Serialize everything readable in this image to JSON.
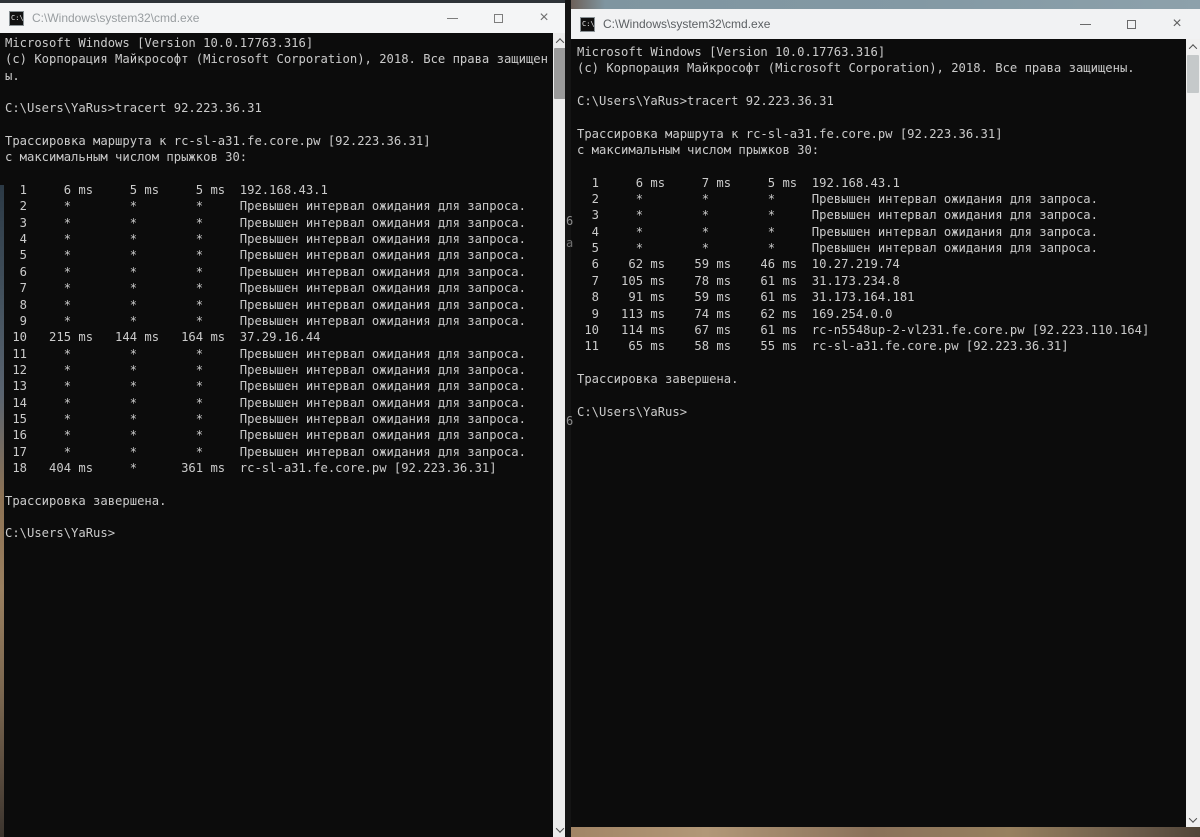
{
  "colors": {
    "console_bg": "#0c0c0c",
    "console_text": "#cbcbcb",
    "titlebar_left": "#f4f5f6",
    "titlebar_right": "#f1f2f3",
    "wallpaper_top": "#8399a4",
    "wallpaper_bottom": "#a18465"
  },
  "left_window": {
    "title": "C:\\Windows\\system32\\cmd.exe",
    "icon_text": "C:\\",
    "controls": {
      "minimize_glyph": "–",
      "maximize_glyph": "□",
      "close_glyph": "×"
    },
    "console_lines": [
      "Microsoft Windows [Version 10.0.17763.316]",
      "(c) Корпорация Майкрософт (Microsoft Corporation), 2018. Все права защищен",
      "ы.",
      "",
      "C:\\Users\\YaRus>tracert 92.223.36.31",
      "",
      "Трассировка маршрута к rc-sl-a31.fe.core.pw [92.223.36.31]",
      "с максимальным числом прыжков 30:",
      "",
      "  1     6 ms     5 ms     5 ms  192.168.43.1",
      "  2     *        *        *     Превышен интервал ожидания для запроса.",
      "  3     *        *        *     Превышен интервал ожидания для запроса.",
      "  4     *        *        *     Превышен интервал ожидания для запроса.",
      "  5     *        *        *     Превышен интервал ожидания для запроса.",
      "  6     *        *        *     Превышен интервал ожидания для запроса.",
      "  7     *        *        *     Превышен интервал ожидания для запроса.",
      "  8     *        *        *     Превышен интервал ожидания для запроса.",
      "  9     *        *        *     Превышен интервал ожидания для запроса.",
      " 10   215 ms   144 ms   164 ms  37.29.16.44",
      " 11     *        *        *     Превышен интервал ожидания для запроса.",
      " 12     *        *        *     Превышен интервал ожидания для запроса.",
      " 13     *        *        *     Превышен интервал ожидания для запроса.",
      " 14     *        *        *     Превышен интервал ожидания для запроса.",
      " 15     *        *        *     Превышен интервал ожидания для запроса.",
      " 16     *        *        *     Превышен интервал ожидания для запроса.",
      " 17     *        *        *     Превышен интервал ожидания для запроса.",
      " 18   404 ms     *      361 ms  rc-sl-a31.fe.core.pw [92.223.36.31]",
      "",
      "Трассировка завершена.",
      "",
      "C:\\Users\\YaRus>"
    ]
  },
  "right_window": {
    "title": "C:\\Windows\\system32\\cmd.exe",
    "icon_text": "C:\\",
    "controls": {
      "minimize_glyph": "–",
      "maximize_glyph": "□",
      "close_glyph": "×"
    },
    "console_lines": [
      "Microsoft Windows [Version 10.0.17763.316]",
      "(c) Корпорация Майкрософт (Microsoft Corporation), 2018. Все права защищены.",
      "",
      "C:\\Users\\YaRus>tracert 92.223.36.31",
      "",
      "Трассировка маршрута к rc-sl-a31.fe.core.pw [92.223.36.31]",
      "с максимальным числом прыжков 30:",
      "",
      "  1     6 ms     7 ms     5 ms  192.168.43.1",
      "  2     *        *        *     Превышен интервал ожидания для запроса.",
      "  3     *        *        *     Превышен интервал ожидания для запроса.",
      "  4     *        *        *     Превышен интервал ожидания для запроса.",
      "  5     *        *        *     Превышен интервал ожидания для запроса.",
      "  6    62 ms    59 ms    46 ms  10.27.219.74",
      "  7   105 ms    78 ms    61 ms  31.173.234.8",
      "  8    91 ms    59 ms    61 ms  31.173.164.181",
      "  9   113 ms    74 ms    62 ms  169.254.0.0",
      " 10   114 ms    67 ms    61 ms  rc-n5548up-2-vl231.fe.core.pw [92.223.110.164]",
      " 11    65 ms    58 ms    55 ms  rc-sl-a31.fe.core.pw [92.223.36.31]",
      "",
      "Трассировка завершена.",
      "",
      "C:\\Users\\YaRus>"
    ]
  },
  "artifacts": {
    "glyphs": [
      {
        "char": "6"
      },
      {
        "char": "а"
      },
      {
        "char": "6"
      }
    ]
  }
}
